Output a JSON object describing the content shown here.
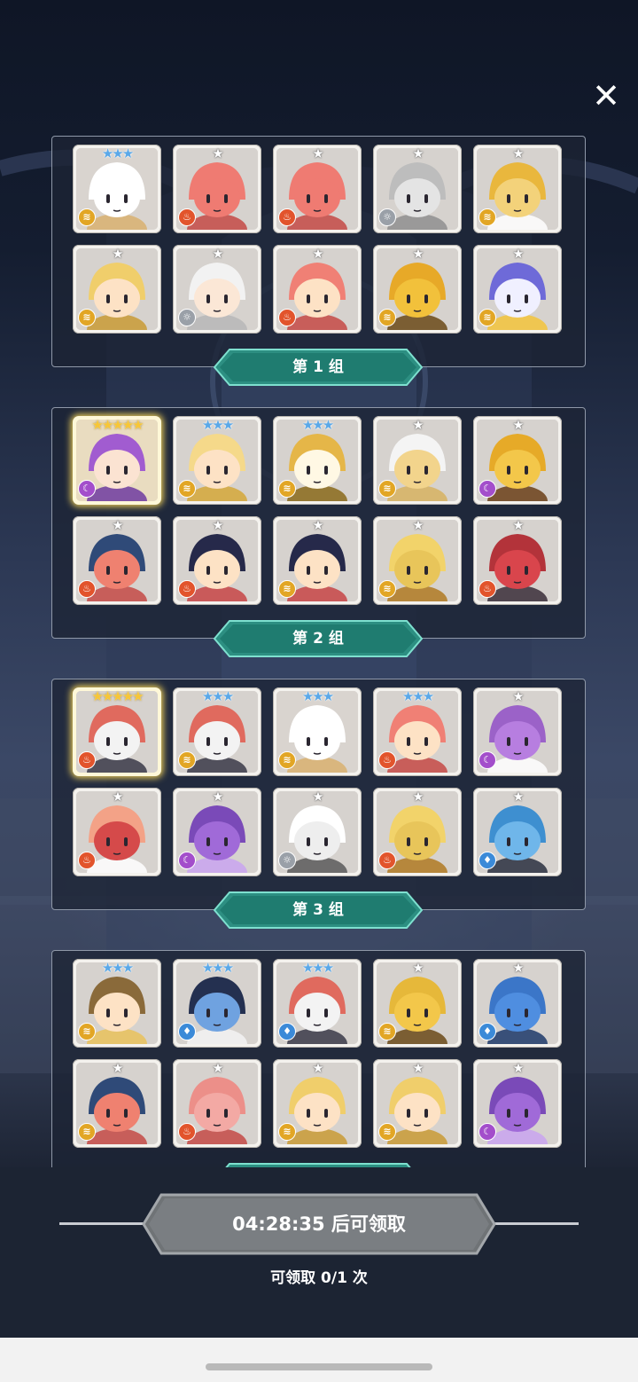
{
  "close_icon": "close-icon",
  "groups": [
    {
      "label": "第 1 组",
      "heroes": [
        {
          "stars": 3,
          "star_color": "#5aa8e8",
          "element": "wind",
          "art": "rabbit"
        },
        {
          "stars": 1,
          "star_color": "#ffffff",
          "element": "fire",
          "art": "octopus"
        },
        {
          "stars": 1,
          "star_color": "#ffffff",
          "element": "fire",
          "art": "octopus"
        },
        {
          "stars": 1,
          "star_color": "#ffffff",
          "element": "light",
          "art": "wolf"
        },
        {
          "stars": 1,
          "star_color": "#ffffff",
          "element": "wind",
          "art": "golden-knight"
        },
        {
          "stars": 1,
          "star_color": "#ffffff",
          "element": "wind",
          "art": "blonde-girl"
        },
        {
          "stars": 1,
          "star_color": "#ffffff",
          "element": "light",
          "art": "white-hair"
        },
        {
          "stars": 1,
          "star_color": "#ffffff",
          "element": "fire",
          "art": "red-hair"
        },
        {
          "stars": 1,
          "star_color": "#ffffff",
          "element": "wind",
          "art": "golden-beast"
        },
        {
          "stars": 1,
          "star_color": "#ffffff",
          "element": "wind",
          "art": "armored-knight"
        }
      ]
    },
    {
      "label": "第 2 组",
      "heroes": [
        {
          "stars": 5,
          "star_color": "#f7c637",
          "element": "dark",
          "art": "purple-hair"
        },
        {
          "stars": 3,
          "star_color": "#5aa8e8",
          "element": "wind",
          "art": "blonde-long"
        },
        {
          "stars": 3,
          "star_color": "#5aa8e8",
          "element": "wind",
          "art": "clock"
        },
        {
          "stars": 1,
          "star_color": "#ffffff",
          "element": "wind",
          "art": "bandaged"
        },
        {
          "stars": 1,
          "star_color": "#ffffff",
          "element": "dark",
          "art": "sunflower"
        },
        {
          "stars": 1,
          "star_color": "#ffffff",
          "element": "fire",
          "art": "bandana-skull"
        },
        {
          "stars": 1,
          "star_color": "#ffffff",
          "element": "fire",
          "art": "black-hair"
        },
        {
          "stars": 1,
          "star_color": "#ffffff",
          "element": "wind",
          "art": "black-hair"
        },
        {
          "stars": 1,
          "star_color": "#ffffff",
          "element": "wind",
          "art": "totem"
        },
        {
          "stars": 1,
          "star_color": "#ffffff",
          "element": "fire",
          "art": "chest"
        }
      ]
    },
    {
      "label": "第 3 组",
      "heroes": [
        {
          "stars": 5,
          "star_color": "#f7c637",
          "element": "fire",
          "art": "mummy"
        },
        {
          "stars": 3,
          "star_color": "#5aa8e8",
          "element": "wind",
          "art": "mummy"
        },
        {
          "stars": 3,
          "star_color": "#5aa8e8",
          "element": "wind",
          "art": "rabbit"
        },
        {
          "stars": 3,
          "star_color": "#5aa8e8",
          "element": "fire",
          "art": "red-hair"
        },
        {
          "stars": 1,
          "star_color": "#ffffff",
          "element": "dark",
          "art": "cactus"
        },
        {
          "stars": 1,
          "star_color": "#ffffff",
          "element": "fire",
          "art": "piranha-flower"
        },
        {
          "stars": 1,
          "star_color": "#ffffff",
          "element": "dark",
          "art": "shell"
        },
        {
          "stars": 1,
          "star_color": "#ffffff",
          "element": "light",
          "art": "white-knight"
        },
        {
          "stars": 1,
          "star_color": "#ffffff",
          "element": "fire",
          "art": "totem"
        },
        {
          "stars": 1,
          "star_color": "#ffffff",
          "element": "water",
          "art": "ice-chest"
        }
      ]
    },
    {
      "label": "",
      "heroes": [
        {
          "stars": 3,
          "star_color": "#5aa8e8",
          "element": "wind",
          "art": "horned-king"
        },
        {
          "stars": 3,
          "star_color": "#5aa8e8",
          "element": "water",
          "art": "blue-face"
        },
        {
          "stars": 3,
          "star_color": "#5aa8e8",
          "element": "water",
          "art": "mummy"
        },
        {
          "stars": 1,
          "star_color": "#ffffff",
          "element": "wind",
          "art": "sun-blob"
        },
        {
          "stars": 1,
          "star_color": "#ffffff",
          "element": "water",
          "art": "blue-cat"
        },
        {
          "stars": 1,
          "star_color": "#ffffff",
          "element": "wind",
          "art": "bandana-skull"
        },
        {
          "stars": 1,
          "star_color": "#ffffff",
          "element": "fire",
          "art": "pink-ghost"
        },
        {
          "stars": 1,
          "star_color": "#ffffff",
          "element": "wind",
          "art": "blonde-girl"
        },
        {
          "stars": 1,
          "star_color": "#ffffff",
          "element": "wind",
          "art": "blonde-girl"
        },
        {
          "stars": 1,
          "star_color": "#ffffff",
          "element": "dark",
          "art": "shell"
        }
      ]
    }
  ],
  "claim_button_label": "04:28:35 后可领取",
  "claim_count_text": "可领取 0/1 次",
  "element_icons": {
    "wind": {
      "glyph": "≋",
      "color": "#e2a625"
    },
    "fire": {
      "glyph": "♨",
      "color": "#e2542c"
    },
    "light": {
      "glyph": "☼",
      "color": "#9aa0a8"
    },
    "dark": {
      "glyph": "☾",
      "color": "#a34ecb"
    },
    "water": {
      "glyph": "♦",
      "color": "#3b8ad8"
    }
  }
}
